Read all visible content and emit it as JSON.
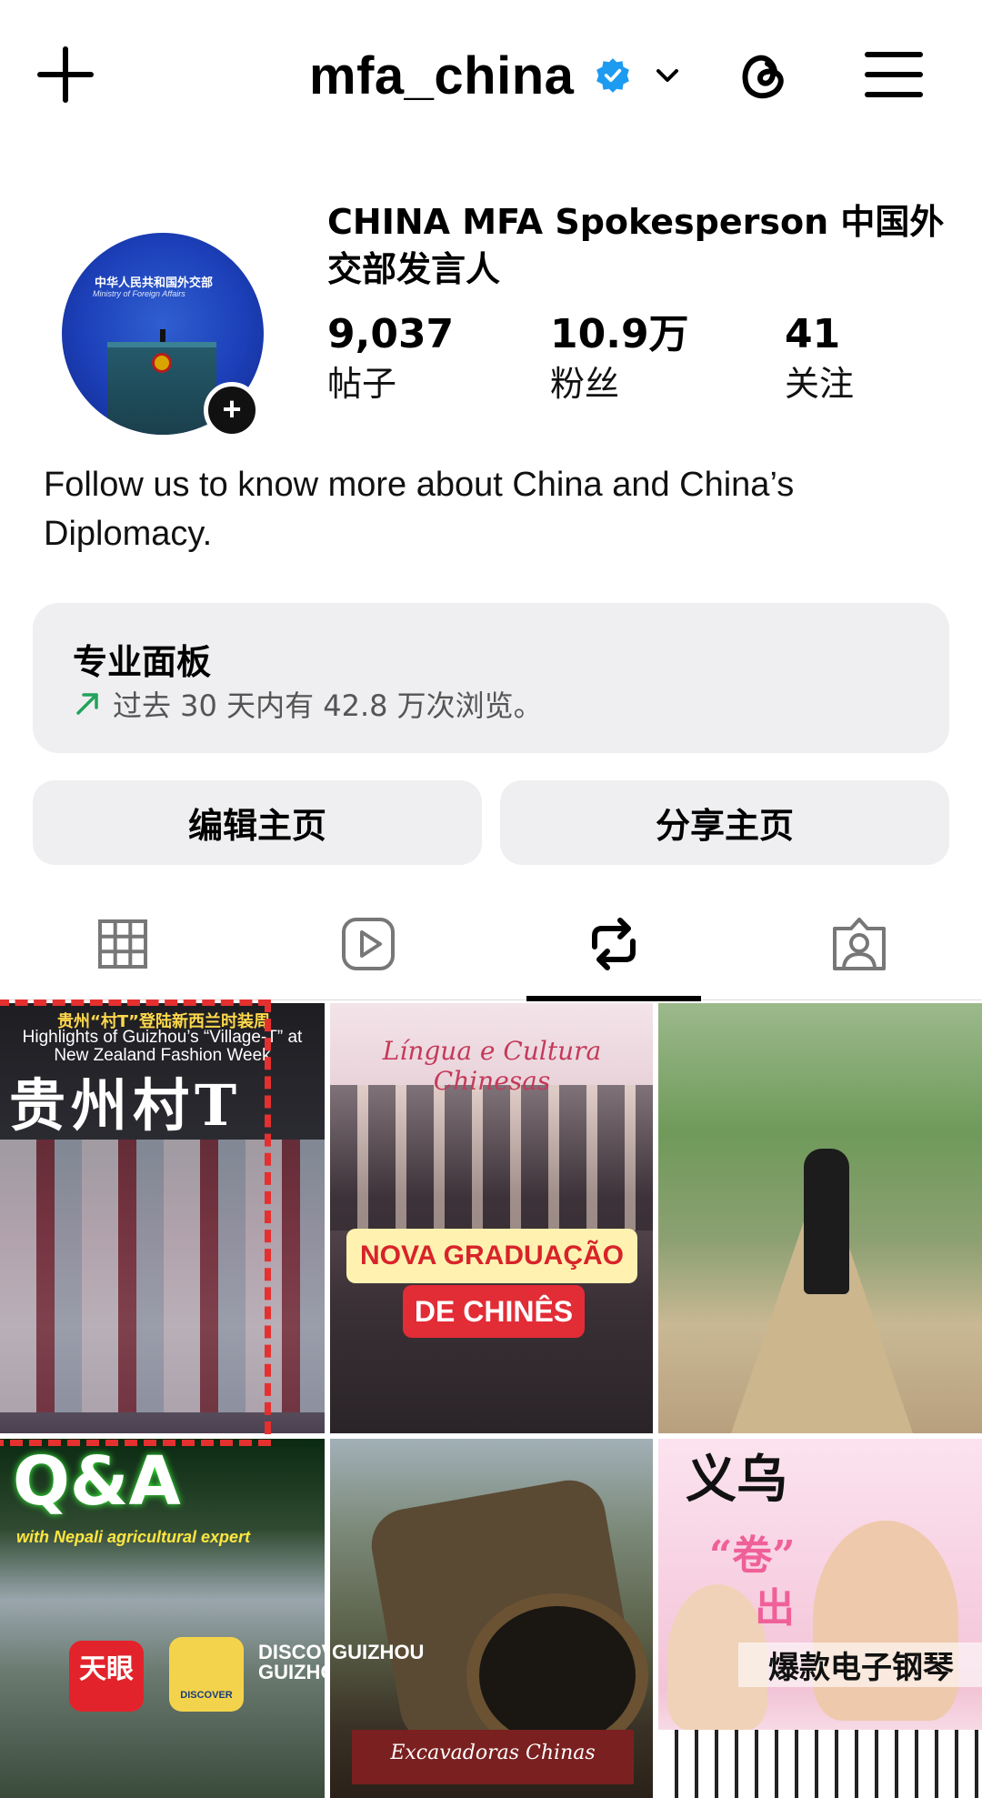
{
  "header": {
    "username": "mfa_china",
    "icons": [
      "plus-icon",
      "verified-badge-icon",
      "chevron-down-icon",
      "threads-icon",
      "menu-icon"
    ]
  },
  "profile": {
    "display_name": "CHINA MFA Spokesperson 中国外交部发言人",
    "avatar_text_cn": "中华人民共和国外交部",
    "avatar_text_en": "Ministry of Foreign Affairs",
    "stats": [
      {
        "value": "9,037",
        "label": "帖子"
      },
      {
        "value": "10.9万",
        "label": "粉丝"
      },
      {
        "value": "41",
        "label": "关注"
      }
    ],
    "bio": "Follow us to know more about China and China’s Diplomacy."
  },
  "dashboard": {
    "title": "专业面板",
    "subtitle": "过去 30 天内有 42.8 万次浏览。"
  },
  "actions": {
    "edit": "编辑主页",
    "share": "分享主页"
  },
  "tabs": {
    "items": [
      "grid-icon",
      "reels-icon",
      "reposts-icon",
      "tagged-icon"
    ],
    "active_index": 2
  },
  "grid": {
    "t1": {
      "small": "贵州“村T”登陆新西兰时装周",
      "en": "Highlights of Guizhou’s “Village-T” at New Zealand Fashion Week",
      "big": "贵州村T"
    },
    "t2": {
      "top": "Língua e Cultura Chinesas",
      "badge1": "NOVA GRADUAÇÃO",
      "badge2": "DE CHINÊS"
    },
    "t4": {
      "qa": "Q&A",
      "sub": "with Nepali agricultural expert",
      "app1": "天眼",
      "app2": "DISCOVER GUIZHOU",
      "disc": "DISCOVER GUIZHOU"
    },
    "t5": {
      "disc": "GUIZHOU",
      "caption": "Excavadoras Chinas"
    },
    "t6": {
      "yiwu": "义乌",
      "juan": "“卷”",
      "chu": "出",
      "bk": "爆款电子钢琴"
    }
  },
  "colors": {
    "accent": "#0095f6",
    "verified": "#1d9bf0",
    "selection": "#e53030",
    "panel": "#efeff1"
  }
}
